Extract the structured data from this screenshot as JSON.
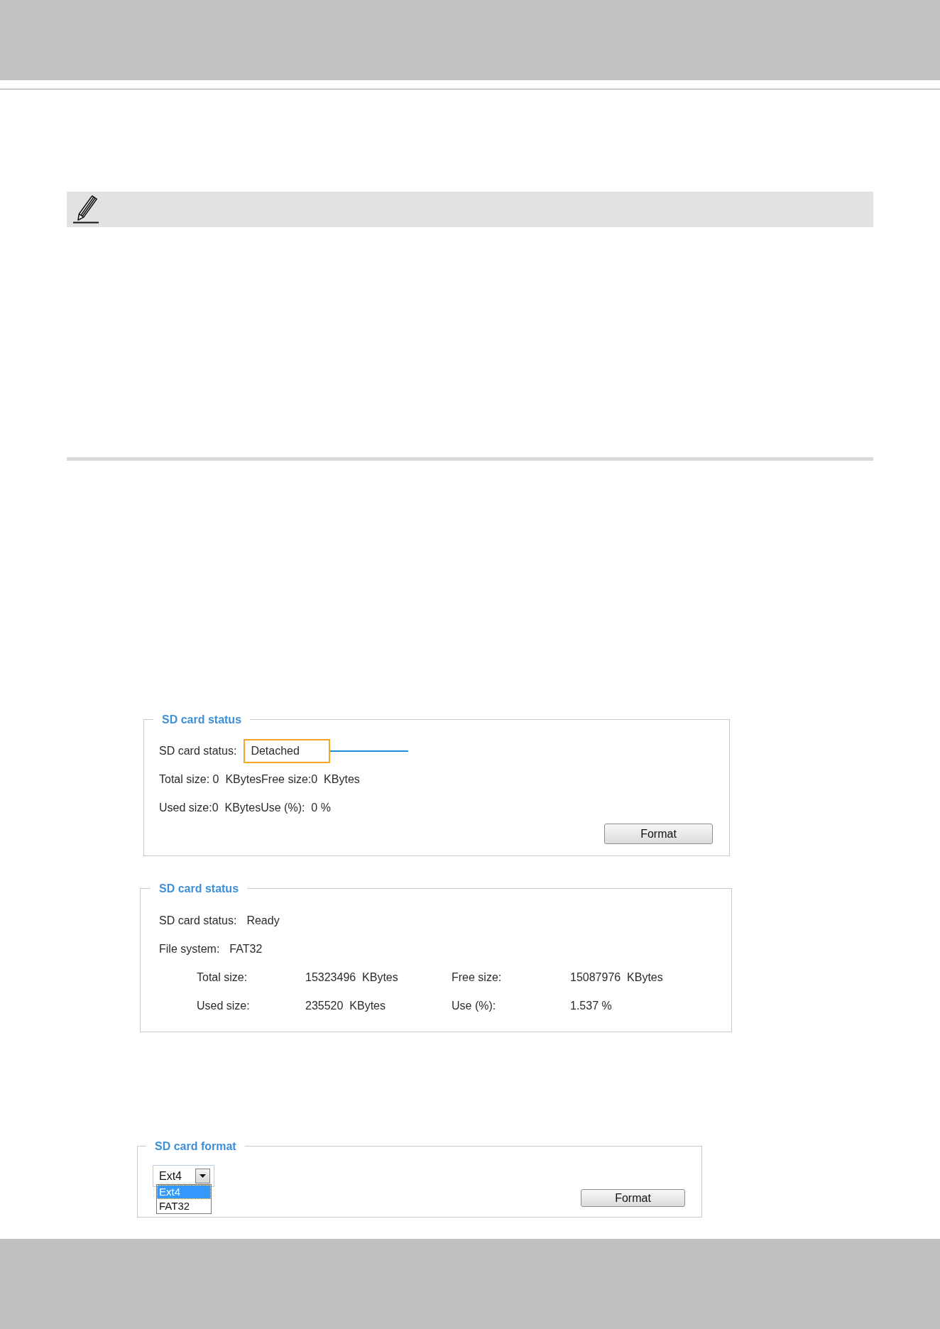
{
  "panels": [
    {
      "kind": "status_summary",
      "title": "SD card status",
      "status": {
        "label": "SD card status:",
        "value": "Detached",
        "highlighted": true
      },
      "lines": [
        "Total size: 0  KBytesFree size:0  KBytes",
        "Used size:0  KBytesUse (%):  0 %"
      ],
      "button": "Format"
    },
    {
      "kind": "status_detail",
      "title": "SD card status",
      "rows": [
        {
          "label": "SD card status:",
          "value": "Ready"
        },
        {
          "label": "File system:",
          "value": "FAT32"
        }
      ],
      "grid": [
        [
          "Total size:",
          "15323496  KBytes",
          "Free size:",
          "15087976  KBytes"
        ],
        [
          "Used size:",
          "235520  KBytes",
          "Use (%):",
          "1.537 %"
        ]
      ]
    },
    {
      "kind": "format",
      "title": "SD card format",
      "select": {
        "value": "Ext4",
        "expanded": true,
        "options": [
          {
            "label": "Ext4",
            "selected": true
          },
          {
            "label": "FAT32",
            "selected": false
          }
        ]
      },
      "button": "Format"
    }
  ]
}
